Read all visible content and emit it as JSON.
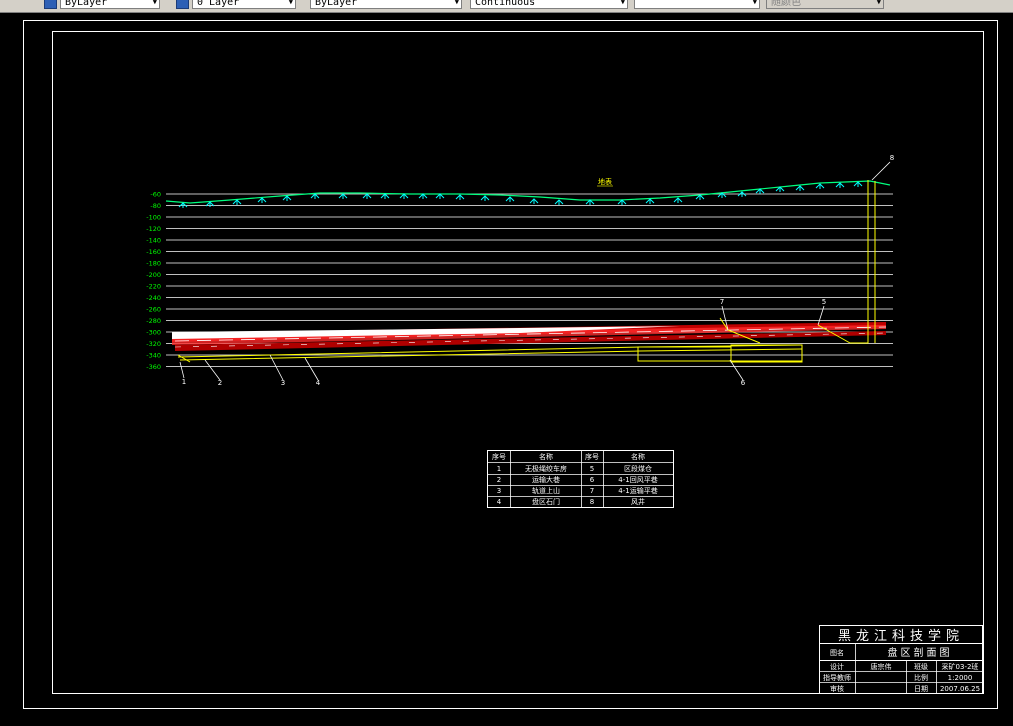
{
  "toolbar": {
    "combo_linetype_scale": "ByLayer",
    "combo_layer": "0 Layer",
    "combo_color": "ByLayer",
    "combo_linetype": "Continuous",
    "combo_lineweight": "",
    "combo_plotstyle": "随颜色"
  },
  "drawing": {
    "depth_labels": [
      "-60",
      "-80",
      "-100",
      "-120",
      "-140",
      "-160",
      "-180",
      "-200",
      "-220",
      "-240",
      "-260",
      "-280",
      "-300",
      "-320",
      "-340",
      "-360"
    ],
    "surface_label": "地表",
    "callouts": [
      "1",
      "2",
      "3",
      "4",
      "5",
      "6",
      "7",
      "8"
    ]
  },
  "legend": {
    "headers": [
      "序号",
      "名称",
      "序号",
      "名称"
    ],
    "rows": [
      [
        "1",
        "无极绳绞车房",
        "5",
        "区段煤仓"
      ],
      [
        "2",
        "运输大巷",
        "6",
        "4-1回风平巷"
      ],
      [
        "3",
        "轨道上山",
        "7",
        "4-1运输平巷"
      ],
      [
        "4",
        "盘区石门",
        "8",
        "风井"
      ]
    ]
  },
  "titleblock": {
    "school": "黑龙江科技学院",
    "label_tuming": "图名",
    "drawing_name": "盘区剖面图",
    "label_design": "设计",
    "designer": "唐宗伟",
    "label_class": "班级",
    "class_name": "采矿03-2班",
    "label_advisor": "指导教师",
    "label_scale": "比例",
    "scale": "1:2000",
    "label_review": "审核",
    "label_date": "日期",
    "date": "2007.06.25"
  },
  "colors": {
    "background": "#000000",
    "frame": "#ffffff",
    "surface": "#00ff7f",
    "surface_marks": "#00ffff",
    "depth_text": "#00ff00",
    "seam": "#ff0000",
    "roadway": "#ffff00"
  }
}
